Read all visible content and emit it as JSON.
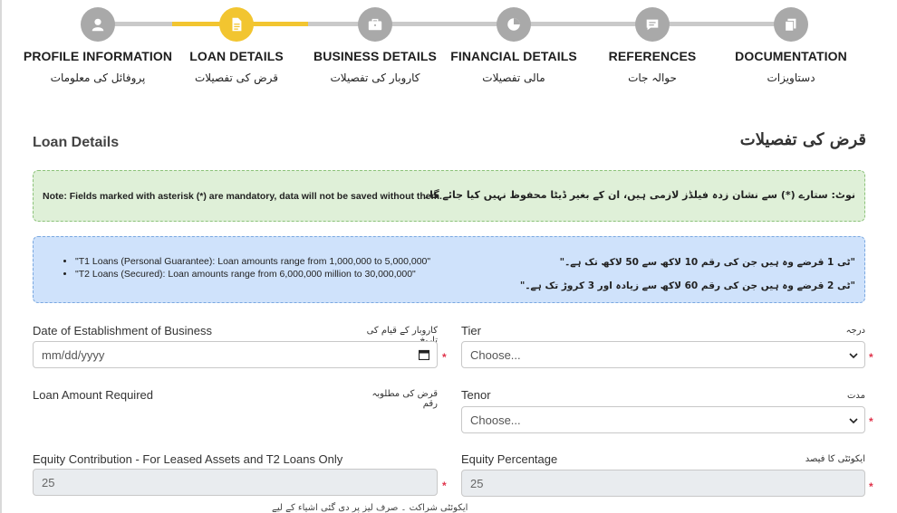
{
  "stepper": {
    "steps": [
      {
        "label": "PROFILE INFORMATION",
        "label_ur": "پروفائل کی معلومات",
        "icon": "user-icon",
        "active": false
      },
      {
        "label": "LOAN DETAILS",
        "label_ur": "قرض کی تفصیلات",
        "icon": "document-icon",
        "active": true
      },
      {
        "label": "BUSINESS DETAILS",
        "label_ur": "کاروبار کی تفصیلات",
        "icon": "briefcase-icon",
        "active": false
      },
      {
        "label": "FINANCIAL DETAILS",
        "label_ur": "مالی تفصیلات",
        "icon": "pie-chart-icon",
        "active": false
      },
      {
        "label": "REFERENCES",
        "label_ur": "حوالہ جات",
        "icon": "chat-icon",
        "active": false
      },
      {
        "label": "DOCUMENTATION",
        "label_ur": "دستاویزات",
        "icon": "files-icon",
        "active": false
      }
    ],
    "colors": {
      "active": "#f2c530",
      "inactive": "#a9a9a9"
    }
  },
  "section": {
    "title": "Loan Details",
    "title_ur": "قرض کی تفصیلات"
  },
  "notes": {
    "mandatory_en": "Note: Fields marked with asterisk (*) are mandatory, data will not be saved without them.",
    "mandatory_ur": "نوٹ: ستارے (*) سے نشان زدہ فیلڈز لازمی ہیں، ان کے بغیر ڈیٹا محفوظ نہیں کیا جائے گا۔",
    "loan_info_en": [
      "\"T1 Loans (Personal Guarantee): Loan amounts range from 1,000,000 to 5,000,000\"",
      "\"T2 Loans (Secured): Loan amounts range from 6,000,000 million to 30,000,000\""
    ],
    "loan_info_ur": [
      "\"ٹی 1 قرضے وہ ہیں جن کی رقم 10 لاکھ سے 50 لاکھ تک ہے۔\"",
      "\"ٹی 2 قرضے وہ ہیں جن کی رقم 60 لاکھ سے زیادہ اور 3 کروڑ تک ہے۔\""
    ]
  },
  "form": {
    "establishment_date": {
      "label": "Date of Establishment of Business",
      "label_ur": "کاروبار کے قیام کی تاریخ",
      "placeholder": "mm/dd/yyyy"
    },
    "tier": {
      "label": "Tier",
      "label_ur": "درجہ",
      "value": "Choose..."
    },
    "loan_amount": {
      "label": "Loan Amount Required",
      "label_ur": "قرض کی مطلوبہ رقم"
    },
    "tenor": {
      "label": "Tenor",
      "label_ur": "مدت",
      "value": "Choose..."
    },
    "equity_contribution": {
      "label": "Equity Contribution - For Leased Assets and T2 Loans Only",
      "value": "25",
      "hint_ur": "ایکوئٹی شراکت ۔ صرف لیز پر دی گئی اشیاء کے لیے"
    },
    "equity_percentage": {
      "label": "Equity Percentage",
      "label_ur": "ایکوئٹی کا فیصد",
      "value": "25"
    },
    "required_mark": "*"
  }
}
